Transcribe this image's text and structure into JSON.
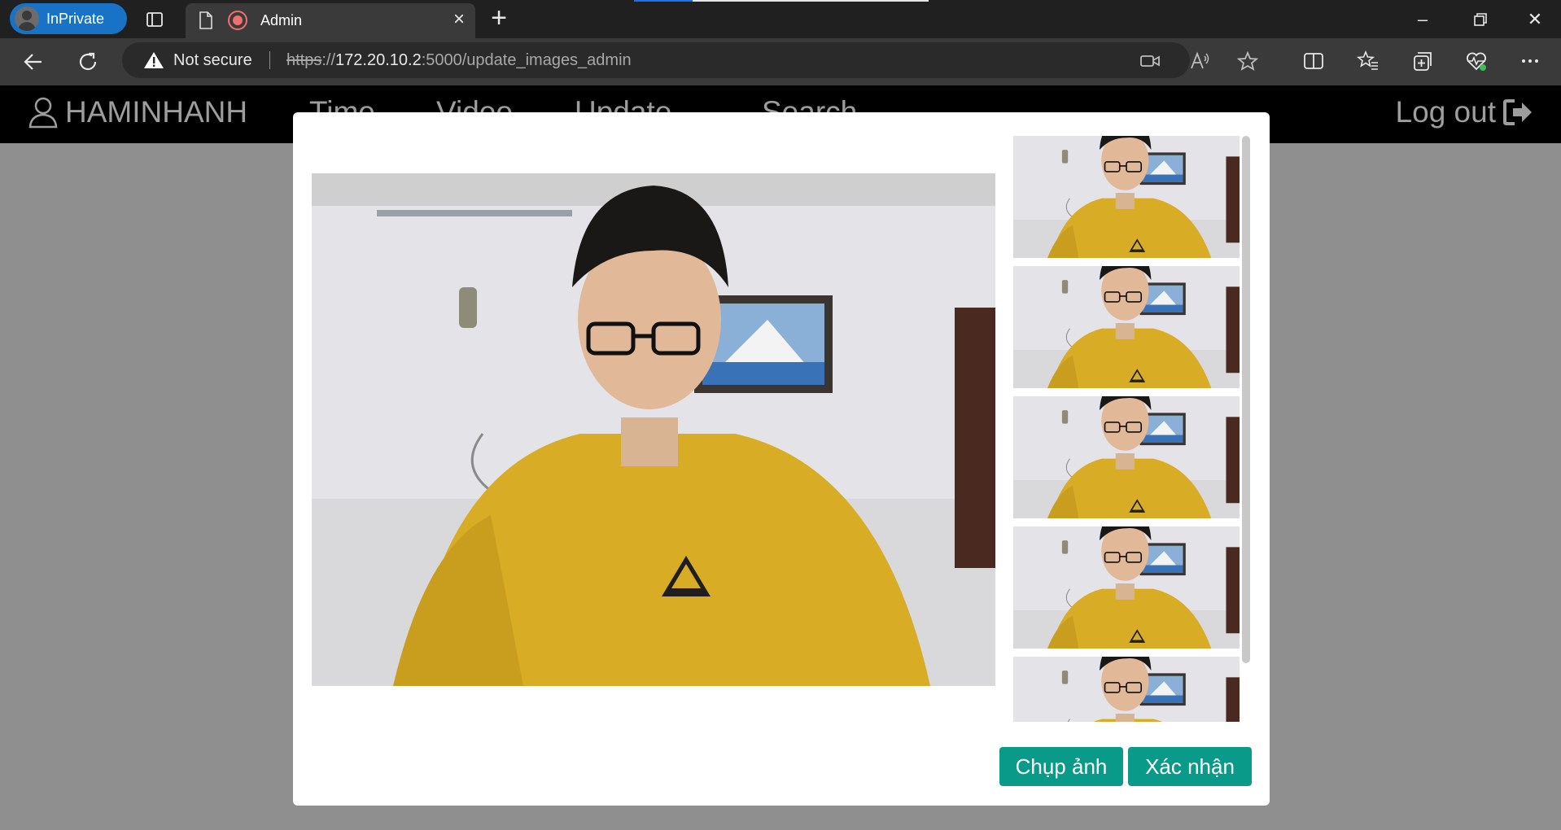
{
  "browser": {
    "profile_label": "InPrivate",
    "tab_title": "Admin",
    "address": {
      "security_label": "Not secure",
      "url_scheme": "https",
      "url_sep": "://",
      "url_host": "172.20.10.2",
      "url_rest": ":5000/update_images_admin"
    }
  },
  "navbar": {
    "brand": "HAMINHANH",
    "links": [
      "Time",
      "Video",
      "Update",
      "Search"
    ],
    "logout_label": "Log out"
  },
  "modal": {
    "capture_button": "Chụp ảnh",
    "confirm_button": "Xác nhận",
    "thumbnail_count": 5
  },
  "colors": {
    "accent_button": "#0a9a8a",
    "profile_badge": "#1873c7",
    "navbar_bg": "#000000",
    "overlay_bg": "#8f8f8f"
  },
  "icons": [
    "user-icon",
    "sign-out-icon",
    "back-icon",
    "refresh-icon",
    "warning-icon",
    "camera-icon",
    "read-aloud-icon",
    "star-icon",
    "split-screen-icon",
    "favorites-icon",
    "collections-icon",
    "health-icon",
    "more-icon"
  ]
}
